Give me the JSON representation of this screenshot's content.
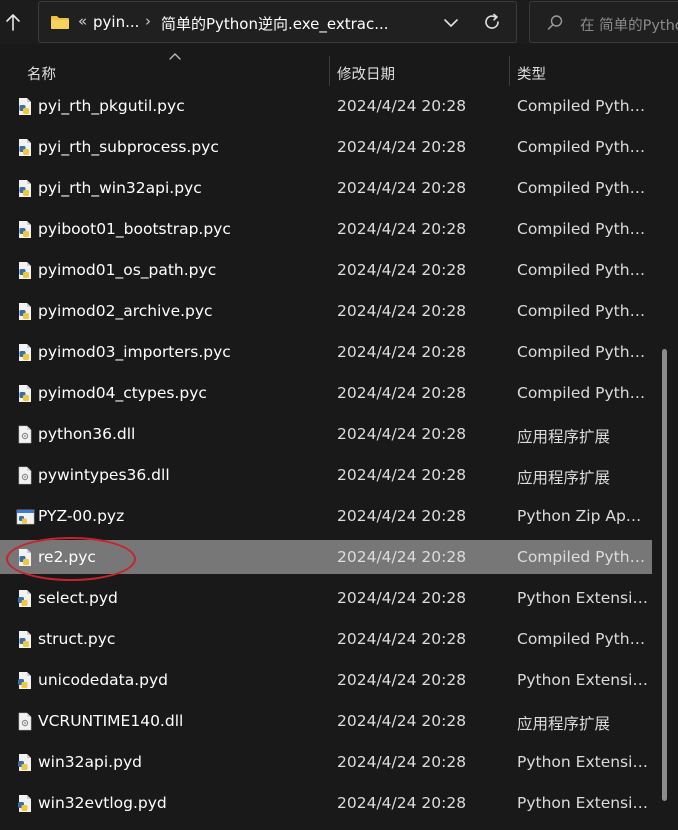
{
  "nav": {
    "up_glyph": "↑"
  },
  "addressbar": {
    "overflow": "«",
    "crumbs": [
      "pyin...",
      "简单的Python逆向.exe_extrac..."
    ],
    "separator": "›"
  },
  "search": {
    "placeholder": "在 简单的Python"
  },
  "columns": {
    "name": "名称",
    "date": "修改日期",
    "type": "类型"
  },
  "files": [
    {
      "name": "pyi_rth_pkgutil.pyc",
      "date": "2024/4/24 20:28",
      "type": "Compiled Pytho...",
      "icon": "pyc-file-icon"
    },
    {
      "name": "pyi_rth_subprocess.pyc",
      "date": "2024/4/24 20:28",
      "type": "Compiled Pytho...",
      "icon": "pyc-file-icon"
    },
    {
      "name": "pyi_rth_win32api.pyc",
      "date": "2024/4/24 20:28",
      "type": "Compiled Pytho...",
      "icon": "pyc-file-icon"
    },
    {
      "name": "pyiboot01_bootstrap.pyc",
      "date": "2024/4/24 20:28",
      "type": "Compiled Pytho...",
      "icon": "pyc-file-icon"
    },
    {
      "name": "pyimod01_os_path.pyc",
      "date": "2024/4/24 20:28",
      "type": "Compiled Pytho...",
      "icon": "pyc-file-icon"
    },
    {
      "name": "pyimod02_archive.pyc",
      "date": "2024/4/24 20:28",
      "type": "Compiled Pytho...",
      "icon": "pyc-file-icon"
    },
    {
      "name": "pyimod03_importers.pyc",
      "date": "2024/4/24 20:28",
      "type": "Compiled Pytho...",
      "icon": "pyc-file-icon"
    },
    {
      "name": "pyimod04_ctypes.pyc",
      "date": "2024/4/24 20:28",
      "type": "Compiled Pytho...",
      "icon": "pyc-file-icon"
    },
    {
      "name": "python36.dll",
      "date": "2024/4/24 20:28",
      "type": "应用程序扩展",
      "icon": "dll-file-icon"
    },
    {
      "name": "pywintypes36.dll",
      "date": "2024/4/24 20:28",
      "type": "应用程序扩展",
      "icon": "dll-file-icon"
    },
    {
      "name": "PYZ-00.pyz",
      "date": "2024/4/24 20:28",
      "type": "Python Zip Appli...",
      "icon": "pyz-file-icon"
    },
    {
      "name": "re2.pyc",
      "date": "2024/4/24 20:28",
      "type": "Compiled Pytho...",
      "icon": "pyc-file-icon",
      "selected": true
    },
    {
      "name": "select.pyd",
      "date": "2024/4/24 20:28",
      "type": "Python Extensio...",
      "icon": "pyd-file-icon"
    },
    {
      "name": "struct.pyc",
      "date": "2024/4/24 20:28",
      "type": "Compiled Pytho...",
      "icon": "pyc-file-icon"
    },
    {
      "name": "unicodedata.pyd",
      "date": "2024/4/24 20:28",
      "type": "Python Extensio...",
      "icon": "pyd-file-icon"
    },
    {
      "name": "VCRUNTIME140.dll",
      "date": "2024/4/24 20:28",
      "type": "应用程序扩展",
      "icon": "dll-file-icon"
    },
    {
      "name": "win32api.pyd",
      "date": "2024/4/24 20:28",
      "type": "Python Extensio...",
      "icon": "pyd-file-icon"
    },
    {
      "name": "win32evtlog.pyd",
      "date": "2024/4/24 20:28",
      "type": "Python Extensio...",
      "icon": "pyd-file-icon"
    }
  ],
  "colors": {
    "background": "#191919",
    "selection": "#777777",
    "annotation": "#c8232c",
    "folder": "#f0c040"
  }
}
